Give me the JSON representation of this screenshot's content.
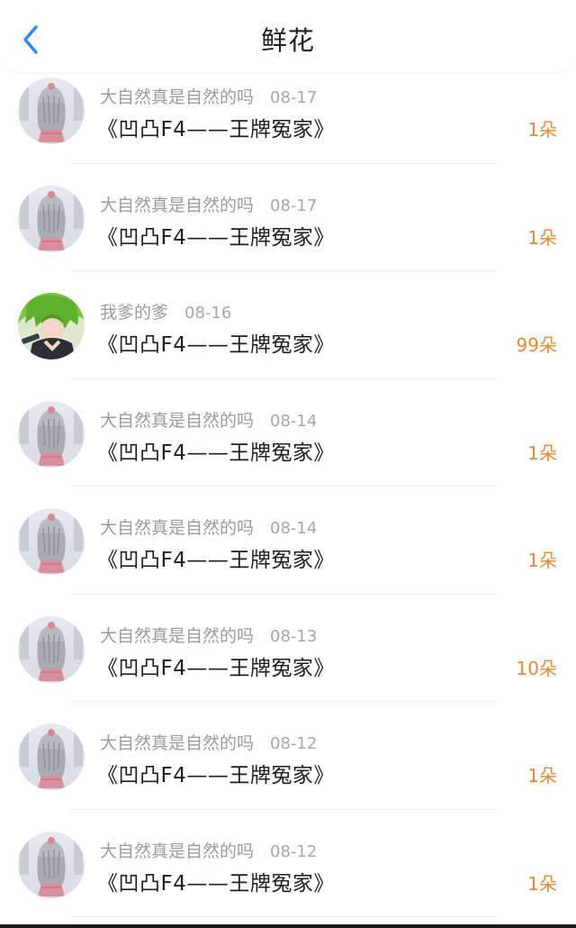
{
  "header": {
    "title": "鲜花",
    "back_icon": "chevron-left-icon",
    "accent_color": "#2a8cf0"
  },
  "colors": {
    "count": "#ee8533",
    "meta": "#9b9b9b"
  },
  "gifts": [
    {
      "user": "大自然真是自然的吗",
      "date": "08-17",
      "book": "《凹凸F4——王牌冤家》",
      "count": "1朵",
      "avatar": "silver-hair-girl-avatar"
    },
    {
      "user": "大自然真是自然的吗",
      "date": "08-17",
      "book": "《凹凸F4——王牌冤家》",
      "count": "1朵",
      "avatar": "silver-hair-girl-avatar"
    },
    {
      "user": "我爹的爹",
      "date": "08-16",
      "book": "《凹凸F4——王牌冤家》",
      "count": "99朵",
      "avatar": "green-hair-character-avatar"
    },
    {
      "user": "大自然真是自然的吗",
      "date": "08-14",
      "book": "《凹凸F4——王牌冤家》",
      "count": "1朵",
      "avatar": "silver-hair-girl-avatar"
    },
    {
      "user": "大自然真是自然的吗",
      "date": "08-14",
      "book": "《凹凸F4——王牌冤家》",
      "count": "1朵",
      "avatar": "silver-hair-girl-avatar"
    },
    {
      "user": "大自然真是自然的吗",
      "date": "08-13",
      "book": "《凹凸F4——王牌冤家》",
      "count": "10朵",
      "avatar": "silver-hair-girl-avatar"
    },
    {
      "user": "大自然真是自然的吗",
      "date": "08-12",
      "book": "《凹凸F4——王牌冤家》",
      "count": "1朵",
      "avatar": "silver-hair-girl-avatar"
    },
    {
      "user": "大自然真是自然的吗",
      "date": "08-12",
      "book": "《凹凸F4——王牌冤家》",
      "count": "1朵",
      "avatar": "silver-hair-girl-avatar"
    }
  ]
}
